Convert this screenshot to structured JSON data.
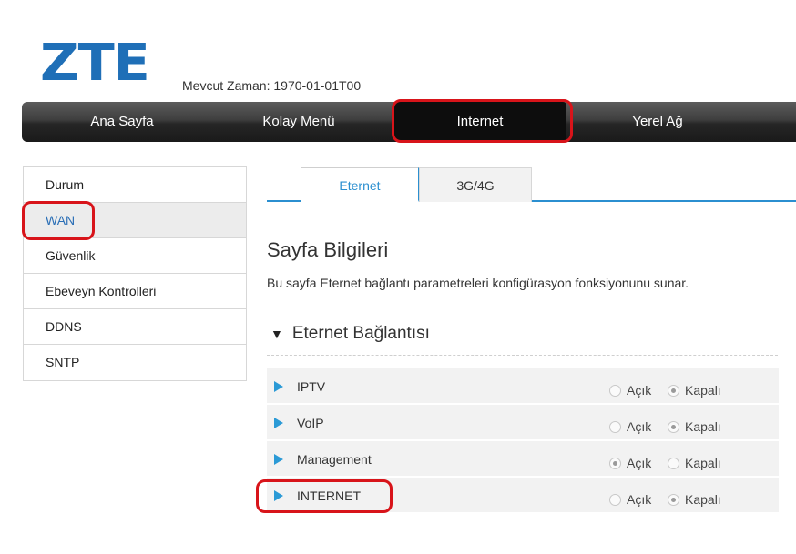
{
  "header": {
    "logo": "ZTE",
    "time_label": "Mevcut Zaman: 1970-01-01T00"
  },
  "nav": {
    "items": [
      {
        "label": "Ana Sayfa"
      },
      {
        "label": "Kolay Menü"
      },
      {
        "label": "Internet"
      },
      {
        "label": "Yerel Ağ"
      }
    ],
    "active": "Internet"
  },
  "sidebar": {
    "items": [
      {
        "label": "Durum"
      },
      {
        "label": "WAN"
      },
      {
        "label": "Güvenlik"
      },
      {
        "label": "Ebeveyn Kontrolleri"
      },
      {
        "label": "DDNS"
      },
      {
        "label": "SNTP"
      }
    ],
    "active": "WAN"
  },
  "tabs": [
    {
      "label": "Eternet"
    },
    {
      "label": "3G/4G"
    }
  ],
  "page": {
    "title": "Sayfa Bilgileri",
    "description": "Bu sayfa Eternet bağlantı parametreleri konfigürasyon fonksiyonunu sunar."
  },
  "section": {
    "arrow": "▼",
    "title": "Eternet Bağlantısı"
  },
  "connections": [
    {
      "name": "IPTV",
      "on_label": "Açık",
      "off_label": "Kapalı",
      "state": "off"
    },
    {
      "name": "VoIP",
      "on_label": "Açık",
      "off_label": "Kapalı",
      "state": "off"
    },
    {
      "name": "Management",
      "on_label": "Açık",
      "off_label": "Kapalı",
      "state": "on"
    },
    {
      "name": "INTERNET",
      "on_label": "Açık",
      "off_label": "Kapalı",
      "state": "off"
    }
  ],
  "colors": {
    "brand": "#1f6fb7",
    "accent": "#2b8fd0",
    "highlight": "#d8141a"
  }
}
